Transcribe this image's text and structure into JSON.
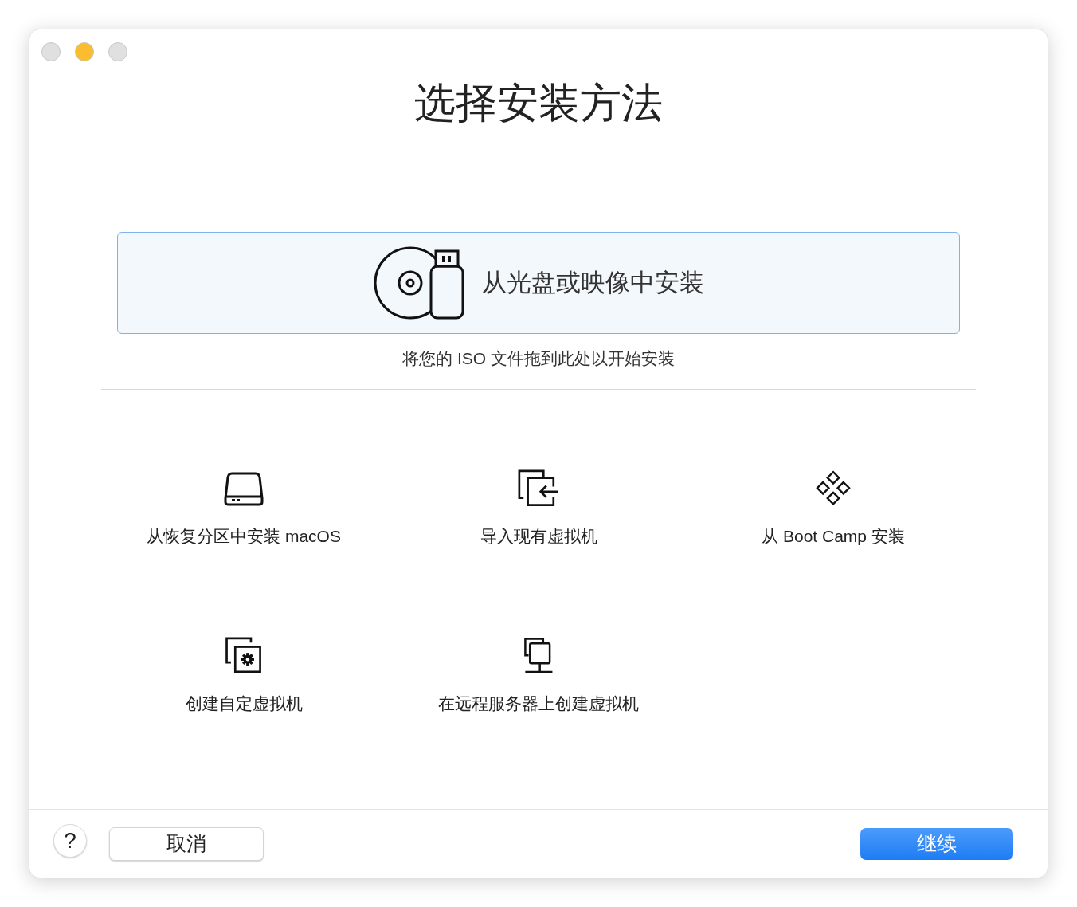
{
  "window": {
    "controls": [
      {
        "color": "#e0e0e0"
      },
      {
        "color": "#fbbc2e"
      },
      {
        "color": "#e0e0e0"
      }
    ]
  },
  "title": "选择安装方法",
  "primary_option": {
    "label": "从光盘或映像中安装",
    "selected": true,
    "hint": "将您的 ISO 文件拖到此处以开始安装"
  },
  "options": [
    {
      "kind": "drive",
      "label": "从恢复分区中安装 macOS"
    },
    {
      "kind": "import",
      "label": "导入现有虚拟机"
    },
    {
      "kind": "bootcamp",
      "label": "从 Boot Camp 安装"
    },
    {
      "kind": "custom",
      "label": "创建自定虚拟机"
    },
    {
      "kind": "remote",
      "label": "在远程服务器上创建虚拟机"
    }
  ],
  "footer": {
    "help": "?",
    "cancel": "取消",
    "continue": "继续"
  }
}
